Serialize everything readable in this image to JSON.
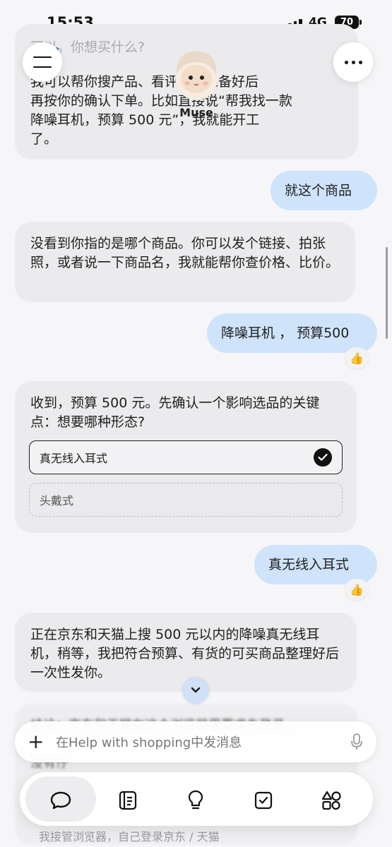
{
  "status_bar": {
    "time": "15:53",
    "network": "4G",
    "battery": "70"
  },
  "header": {
    "assistant_name": "Muse"
  },
  "messages": {
    "m1_partial_top": "可以。你想买什么?",
    "m1_lines": [
      "我可以帮你搜产品、看评价，准备好后",
      "再按你的确认下单。比如直接说“帮我找一款",
      "降噪耳机，预算 500 元”，我就能开工",
      "了。"
    ],
    "m2_user": "就这个商品",
    "m3_bot": "没看到你指的是哪个商品。你可以发个链接、拍张照，或者说一下商品名，我就能帮你查价格、比价。",
    "m4_user": "降噪耳机 ， 预算500",
    "m5_bot": "收到，预算 500 元。先确认一个影响选品的关键点：想要哪种形态?",
    "m5_options": [
      {
        "label": "真无线入耳式",
        "selected": true
      },
      {
        "label": "头戴式",
        "selected": false
      }
    ],
    "m6_user": "真无线入耳式",
    "m7_bot": "正在京东和天猫上搜 500 元以内的降噪真无线耳机，稍等，我把符合预算、有货的可买商品整理好后一次性发你。",
    "m8_partial_lines": [
      "结论：京东和天猫在这个浏览器里要求先登录，",
      "没有仔",
      "我接管浏览器，自己登录京东 / 天猫"
    ]
  },
  "composer": {
    "placeholder": "在Help with shopping中发消息"
  },
  "nav": {
    "items": [
      {
        "icon": "chat-bubble-icon",
        "active": true
      },
      {
        "icon": "notes-icon",
        "active": false
      },
      {
        "icon": "lightbulb-icon",
        "active": false
      },
      {
        "icon": "checkbox-icon",
        "active": false
      },
      {
        "icon": "apps-icon",
        "active": false
      }
    ]
  },
  "colors": {
    "user_bubble": "#cfe4fb",
    "bot_bubble": "#ebebed",
    "accent_dot": "#2563eb"
  }
}
